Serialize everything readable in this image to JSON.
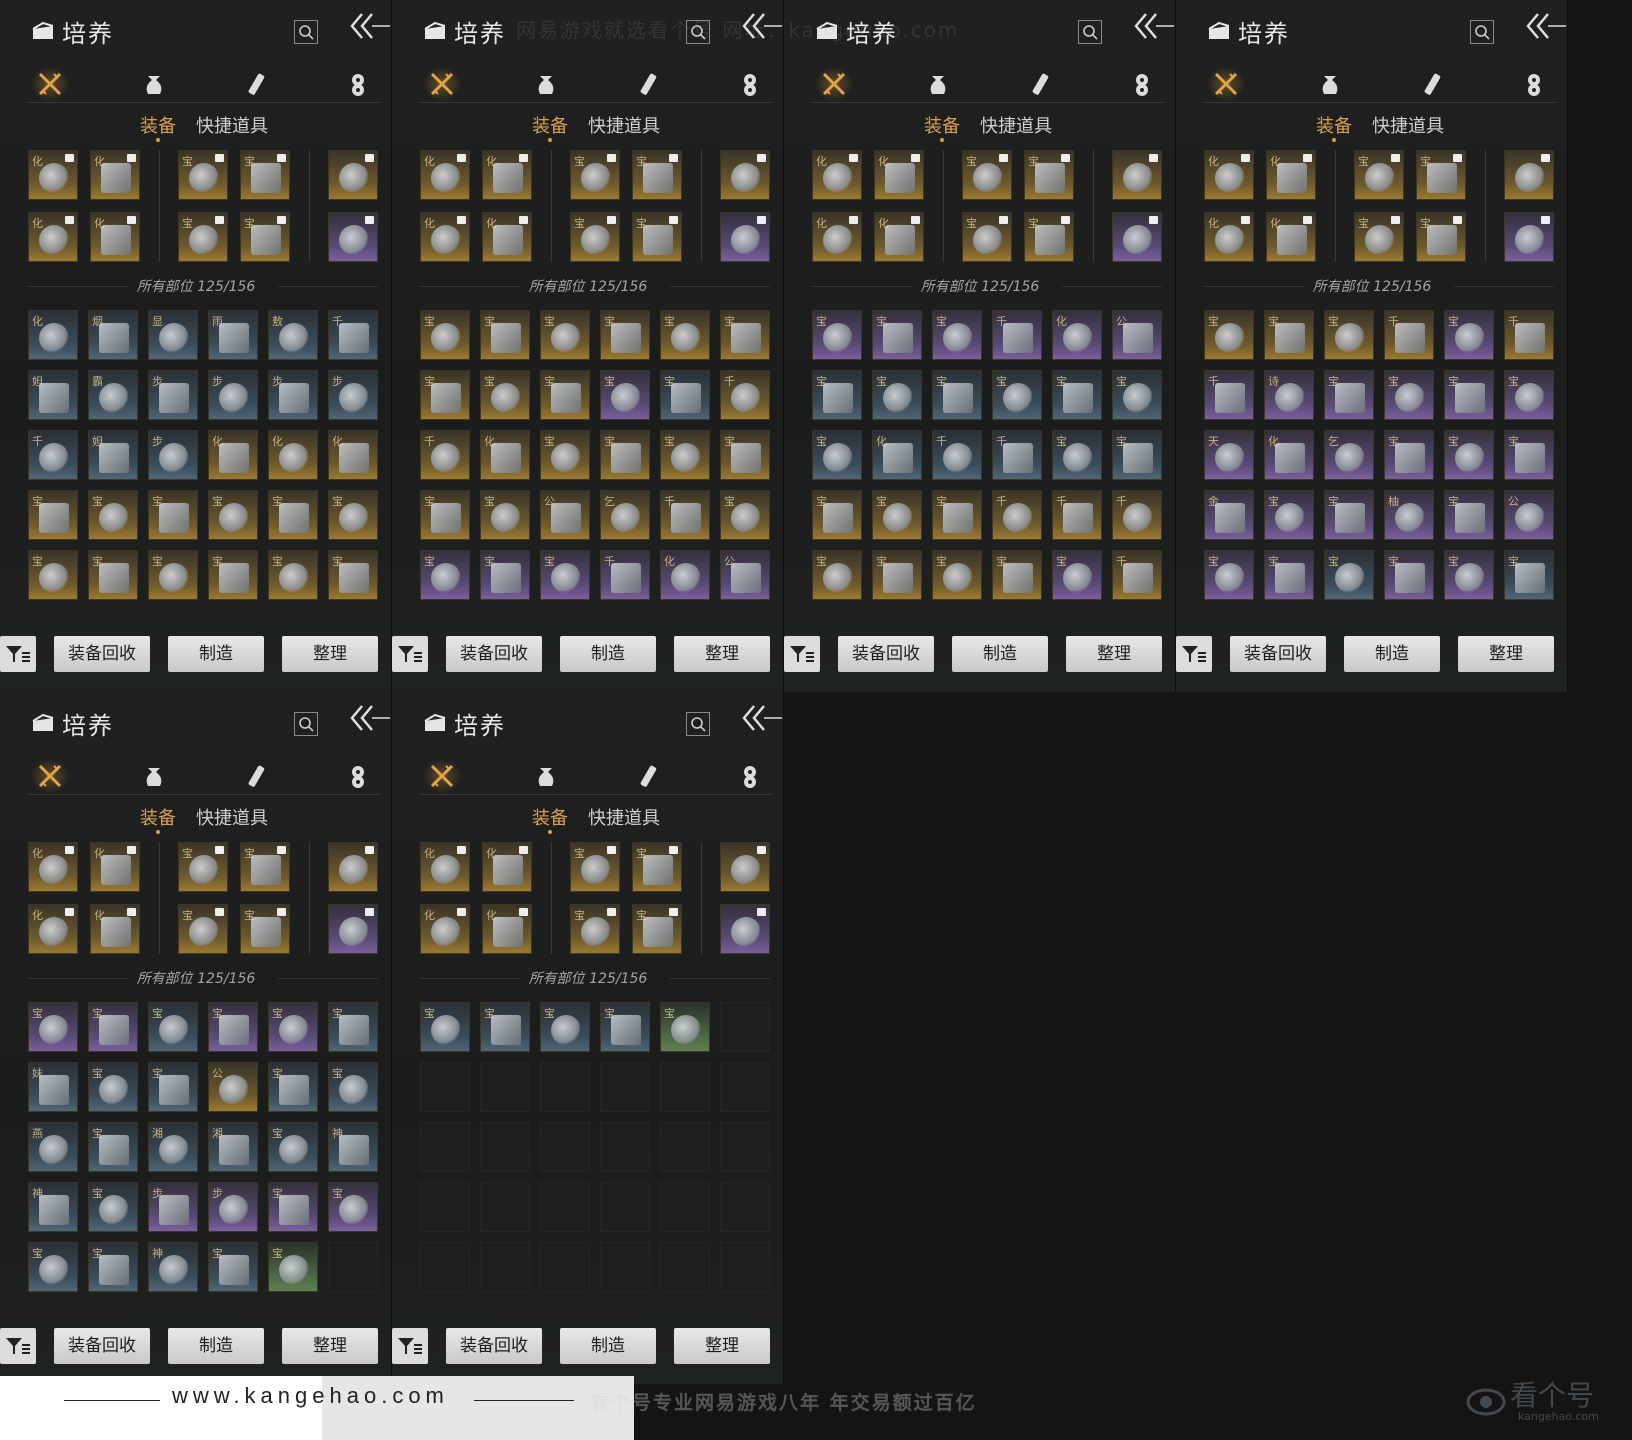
{
  "watermark_top": "网易游戏就选看个号  网址：kangehao.com",
  "footer": {
    "url": "www.kangehao.com",
    "slogan": "看个号专业网易游戏八年   年交易额过百亿",
    "logo_text": "看个号",
    "logo_sub": "kangehao.com"
  },
  "panel_common": {
    "title": "培养",
    "subtab_equipment": "装备",
    "subtab_quick_items": "快捷道具",
    "count_label": "所有部位 125/156",
    "btn_recycle": "装备回收",
    "btn_craft": "制造",
    "btn_sort": "整理",
    "categories": [
      "sword-icon",
      "pouch-icon",
      "scroll-icon",
      "token-icon"
    ]
  },
  "equipped": {
    "row1": [
      {
        "q": "化",
        "tier": "gold"
      },
      {
        "q": "化",
        "tier": "gold"
      },
      {
        "q": "宝",
        "tier": "gold"
      },
      {
        "q": "宝",
        "tier": "gold"
      },
      {
        "q": "",
        "tier": "gold"
      }
    ],
    "row2": [
      {
        "q": "化",
        "tier": "gold"
      },
      {
        "q": "化",
        "tier": "gold"
      },
      {
        "q": "宝",
        "tier": "gold"
      },
      {
        "q": "宝",
        "tier": "gold"
      },
      {
        "q": "",
        "tier": "purple"
      }
    ]
  },
  "panels": [
    {
      "id": "p1",
      "grid": [
        [
          "化:blue",
          "烟:blue",
          "显:blue",
          "雨:blue",
          "敖:blue",
          "千:blue"
        ],
        [
          "妲:blue",
          "霸:blue",
          "步:blue",
          "步:blue",
          "步:blue",
          "步:blue"
        ],
        [
          "千:blue",
          "妲:blue",
          "步:blue",
          "化:gold",
          "化:gold",
          "化:gold"
        ],
        [
          "宝:gold",
          "宝:gold",
          "宝:gold",
          "宝:gold",
          "宝:gold",
          "宝:gold"
        ],
        [
          "宝:gold",
          "宝:gold",
          "宝:gold",
          "宝:gold",
          "宝:gold",
          "宝:gold"
        ]
      ]
    },
    {
      "id": "p2",
      "grid": [
        [
          "宝:gold",
          "宝:gold",
          "宝:gold",
          "宝:gold",
          "宝:gold",
          "宝:gold"
        ],
        [
          "宝:gold",
          "宝:gold",
          "宝:gold",
          "宝:purple",
          "宝:blue",
          "千:gold"
        ],
        [
          "千:gold",
          "化:gold",
          "宝:gold",
          "宝:gold",
          "宝:gold",
          "宝:gold"
        ],
        [
          "宝:gold",
          "宝:gold",
          "公:gold",
          "乞:gold",
          "千:gold",
          "宝:gold"
        ],
        [
          "宝:purple",
          "宝:purple",
          "宝:purple",
          "千:purple",
          "化:purple",
          "公:purple"
        ]
      ]
    },
    {
      "id": "p3",
      "grid": [
        [
          "宝:purple",
          "宝:purple",
          "宝:purple",
          "千:purple",
          "化:purple",
          "公:purple"
        ],
        [
          "宝:blue",
          "宝:blue",
          "宝:blue",
          "宝:blue",
          "宝:blue",
          "宝:blue"
        ],
        [
          "宝:blue",
          "化:blue",
          "千:blue",
          "千:blue",
          "宝:blue",
          "宝:blue"
        ],
        [
          "宝:gold",
          "宝:gold",
          "宝:gold",
          "千:gold",
          "千:gold",
          "千:gold"
        ],
        [
          "宝:gold",
          "宝:gold",
          "宝:gold",
          "宝:gold",
          "宝:purple",
          "千:gold"
        ]
      ]
    },
    {
      "id": "p4",
      "grid": [
        [
          "宝:gold",
          "宝:gold",
          "宝:gold",
          "千:gold",
          "宝:purple",
          "千:gold"
        ],
        [
          "千:purple",
          "诗:purple",
          "宝:purple",
          "宝:purple",
          "宝:purple",
          "宝:purple"
        ],
        [
          "天:purple",
          "化:purple",
          "乞:purple",
          "宝:purple",
          "宝:purple",
          "宝:purple"
        ],
        [
          "金:purple",
          "宝:purple",
          "宝:purple",
          "柚:purple",
          "宝:purple",
          "公:purple"
        ],
        [
          "宝:purple",
          "宝:purple",
          "宝:blue",
          "宝:purple",
          "宝:purple",
          "宝:blue"
        ]
      ]
    },
    {
      "id": "p5",
      "grid": [
        [
          "宝:purple",
          "宝:purple",
          "宝:blue",
          "宝:purple",
          "宝:purple",
          "宝:blue"
        ],
        [
          "妹:blue",
          "宝:blue",
          "宝:blue",
          "公:gold",
          "宝:blue",
          "宝:blue"
        ],
        [
          "燕:blue",
          "宝:blue",
          "湘:blue",
          "湘:blue",
          "宝:blue",
          "神:blue"
        ],
        [
          "神:blue",
          "宝:blue",
          "步:purple",
          "步:purple",
          "宝:purple",
          "宝:purple"
        ],
        [
          "宝:blue",
          "宝:blue",
          "神:blue",
          "宝:blue",
          "宝:green",
          "空:empty"
        ]
      ]
    },
    {
      "id": "p6",
      "grid": [
        [
          "宝:blue",
          "宝:blue",
          "宝:blue",
          "宝:blue",
          "宝:green",
          "空:empty"
        ],
        [
          "空:empty",
          "空:empty",
          "空:empty",
          "空:empty",
          "空:empty",
          "空:empty"
        ],
        [
          "空:empty",
          "空:empty",
          "空:empty",
          "空:empty",
          "空:empty",
          "空:empty"
        ],
        [
          "空:empty",
          "空:empty",
          "空:empty",
          "空:empty",
          "空:empty",
          "空:empty"
        ],
        [
          "空:empty",
          "空:empty",
          "空:empty",
          "空:empty",
          "空:empty",
          "空:empty"
        ]
      ]
    }
  ]
}
